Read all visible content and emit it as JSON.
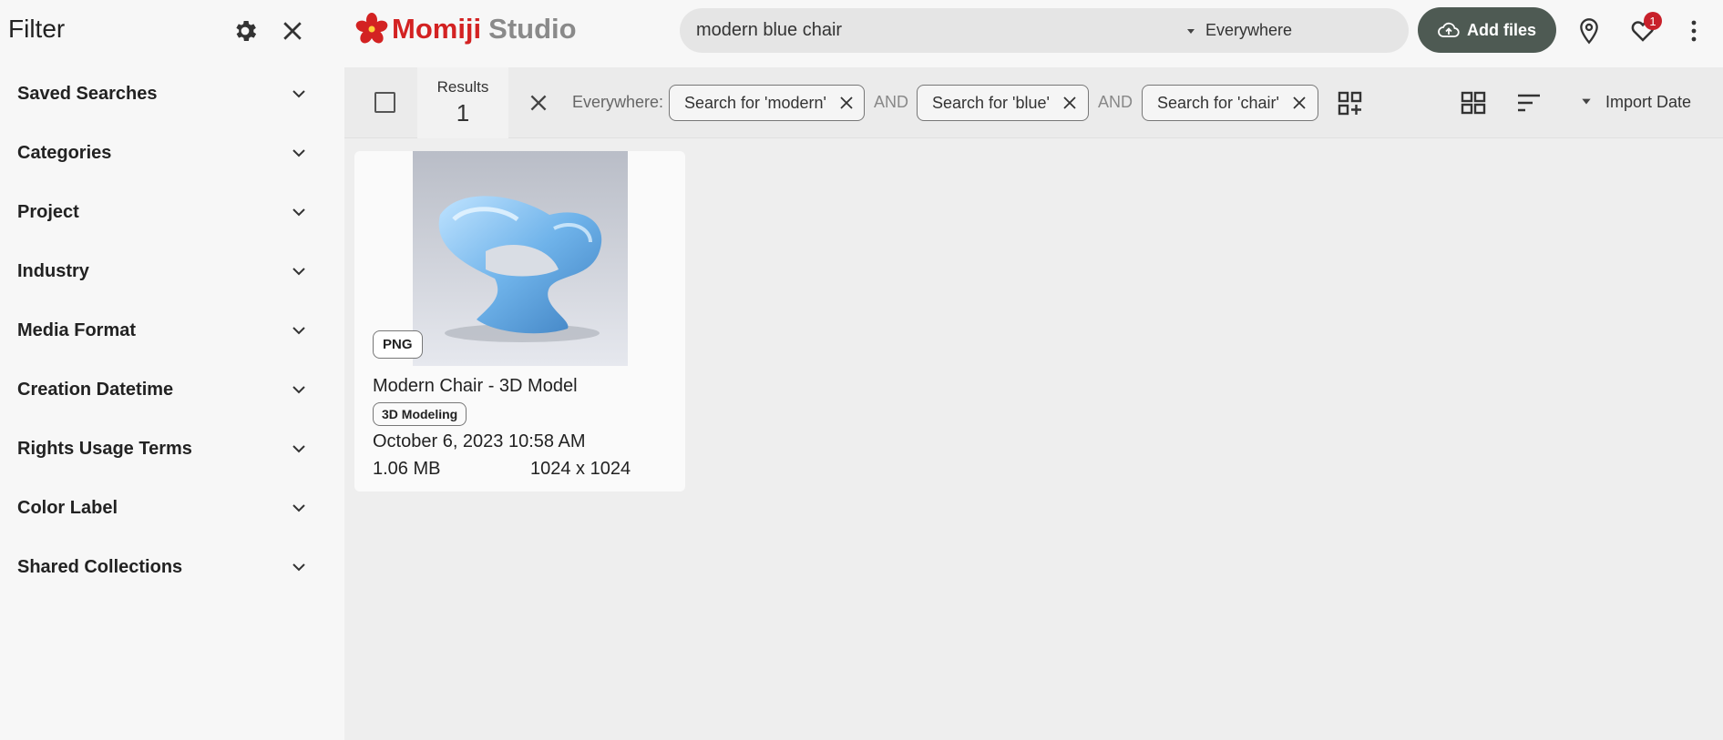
{
  "sidebar": {
    "title": "Filter",
    "items": [
      {
        "label": "Saved Searches"
      },
      {
        "label": "Categories"
      },
      {
        "label": "Project"
      },
      {
        "label": "Industry"
      },
      {
        "label": "Media Format"
      },
      {
        "label": "Creation Datetime"
      },
      {
        "label": "Rights Usage Terms"
      },
      {
        "label": "Color Label"
      },
      {
        "label": "Shared Collections"
      }
    ]
  },
  "header": {
    "logo_primary": "Momiji",
    "logo_secondary": "Studio",
    "search_value": "modern blue chair",
    "search_scope": "Everywhere",
    "add_files_label": "Add files",
    "notification_count": "1"
  },
  "toolbar": {
    "results_label": "Results",
    "results_count": "1",
    "scope_label": "Everywhere:",
    "chips": [
      {
        "label": "Search for 'modern'"
      },
      {
        "label": "Search for 'blue'"
      },
      {
        "label": "Search for 'chair'"
      }
    ],
    "operator": "AND",
    "sort_label": "Import Date"
  },
  "results": [
    {
      "format": "PNG",
      "title": "Modern Chair - 3D Model",
      "tag": "3D Modeling",
      "date": "October 6, 2023 10:58 AM",
      "size": "1.06 MB",
      "dimensions": "1024 x 1024"
    }
  ],
  "colors": {
    "brand_red": "#d32222",
    "button_bg": "#4e5a53",
    "badge_red": "#c8202a"
  }
}
